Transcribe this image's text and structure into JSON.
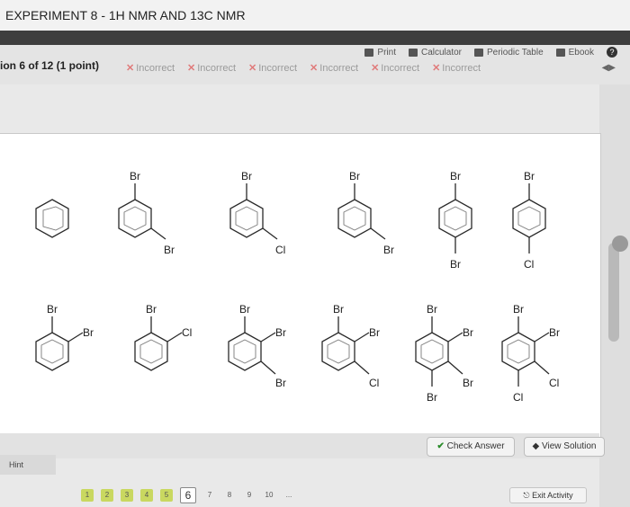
{
  "header": {
    "title": "EXPERIMENT 8 - 1H NMR AND 13C NMR"
  },
  "toolbar": {
    "print": "Print",
    "calculator": "Calculator",
    "periodic_table": "Periodic Table",
    "ebook": "Ebook",
    "help": "?"
  },
  "question": {
    "status": "ion 6 of 12 (1 point)",
    "attempts": [
      "Incorrect",
      "Incorrect",
      "Incorrect",
      "Incorrect",
      "Incorrect",
      "Incorrect"
    ]
  },
  "molecules": {
    "top_row": [
      {
        "labels": []
      },
      {
        "labels": [
          "Br",
          "Br"
        ]
      },
      {
        "labels": [
          "Br",
          "Cl"
        ]
      },
      {
        "labels": [
          "Br",
          "Br"
        ]
      },
      {
        "labels": [
          "Br",
          "Br"
        ]
      },
      {
        "labels": [
          "Br",
          "Cl"
        ]
      }
    ],
    "bottom_row": [
      {
        "labels": [
          "Br",
          "Br"
        ]
      },
      {
        "labels": [
          "Br",
          "Cl"
        ]
      },
      {
        "labels": [
          "Br",
          "Br",
          "Br"
        ]
      },
      {
        "labels": [
          "Br",
          "Br",
          "Cl"
        ]
      },
      {
        "labels": [
          "Br",
          "Br",
          "Br",
          "Br"
        ]
      },
      {
        "labels": [
          "Br",
          "Br",
          "Cl",
          "Cl"
        ]
      }
    ]
  },
  "actions": {
    "check_answer": "Check Answer",
    "view_solution": "View Solution",
    "hint": "Hint"
  },
  "pagination": {
    "pages": [
      "1",
      "2",
      "3",
      "4",
      "5",
      "6",
      "7",
      "8",
      "9",
      "10"
    ],
    "current": "6",
    "more": "...",
    "exit": "Exit Activity"
  }
}
